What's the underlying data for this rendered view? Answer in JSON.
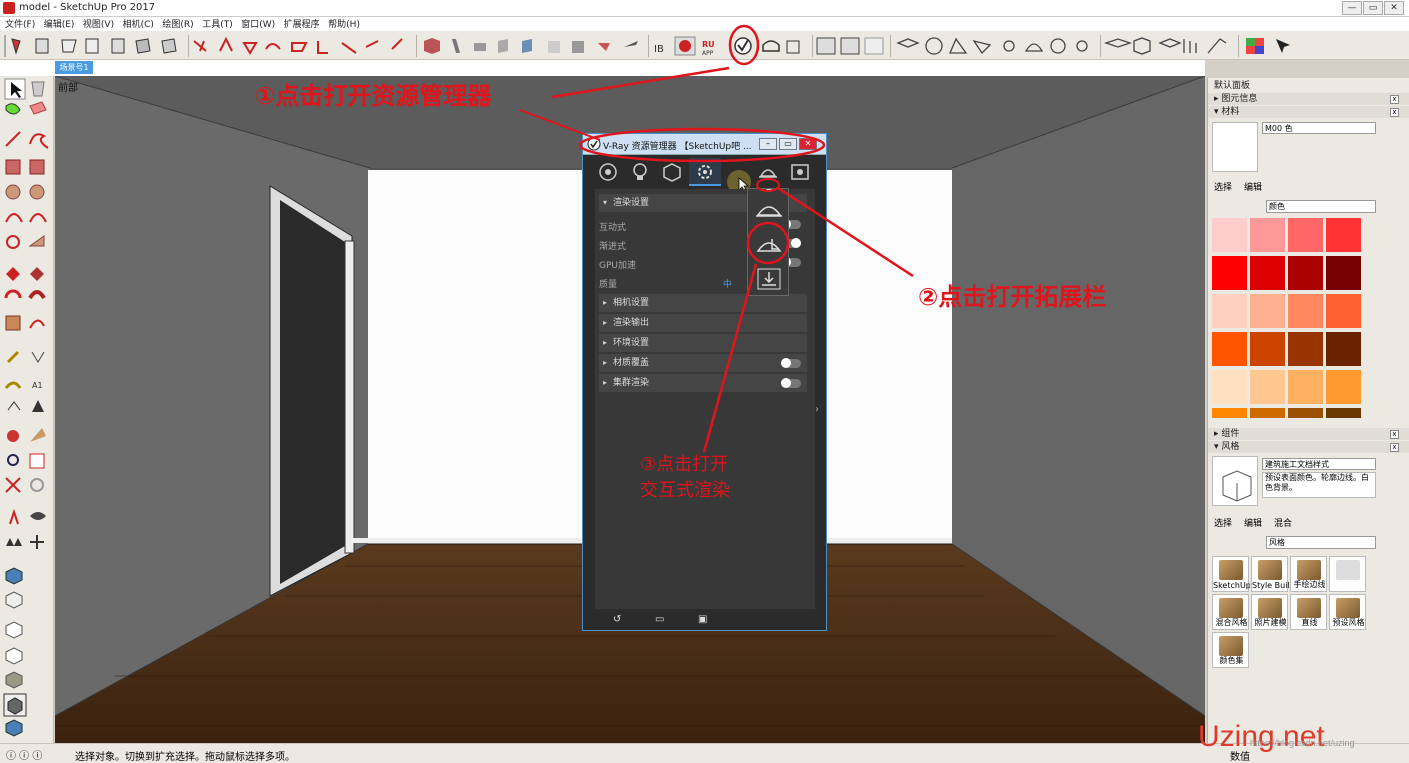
{
  "window": {
    "title": "model - SketchUp Pro 2017",
    "minimize": "—",
    "restore": "▭",
    "close": "✕"
  },
  "menu": [
    "文件(F)",
    "编辑(E)",
    "视图(V)",
    "相机(C)",
    "绘图(R)",
    "工具(T)",
    "窗口(W)",
    "扩展程序",
    "帮助(H)"
  ],
  "scene": {
    "tab_label": "场景号1",
    "view_label": "前部"
  },
  "vray": {
    "title": "V-Ray 资源管理器 【SketchUp吧 ...",
    "sections": {
      "render_settings": "渲染设置",
      "camera": "相机设置",
      "output": "渲染输出",
      "environment": "环境设置",
      "material_override": "材质覆盖",
      "swarm": "集群渲染"
    },
    "props": {
      "interactive": "互动式",
      "progressive": "渐进式",
      "gpu": "GPU加速",
      "quality": "质量",
      "quality_value": "中"
    },
    "toggles": {
      "interactive": false,
      "progressive": true,
      "gpu": false,
      "material_override": false,
      "swarm": false
    }
  },
  "annotations": {
    "step1": "①点击打开资源管理器",
    "step2": "②点击打开拓展栏",
    "step3_line1": "③点击打开",
    "step3_line2": "交互式渲染"
  },
  "tray": {
    "title": "默认面板",
    "entity_info": "图元信息",
    "materials": "材料",
    "material_name": "M00 色",
    "select_tab": "选择",
    "edit_tab": "编辑",
    "color_dropdown": "颜色",
    "components": "组件",
    "styles": "风格",
    "style_name": "建筑施工文档样式",
    "style_desc": "预设表面颜色。轮廓边线。白色背景。",
    "style_select_tab": "选择",
    "style_edit_tab": "编辑",
    "style_mix_tab": "混合",
    "style_dropdown": "风格",
    "style_items": [
      "SketchUp",
      "Style Buil",
      "手绘边线",
      "",
      "混合风格",
      "照片建模",
      "直线",
      "预设风格",
      "颜色集"
    ]
  },
  "swatch_colors": [
    "#ffcccc",
    "#ff9999",
    "#ff6666",
    "#ff3333",
    "#ff0000",
    "#dd0000",
    "#aa0000",
    "#770000",
    "#ffd0c0",
    "#ffb090",
    "#ff8860",
    "#ff6030",
    "#ff5500",
    "#cc4400",
    "#993300",
    "#6a2200",
    "#ffe0c0",
    "#ffc890",
    "#ffb060",
    "#ff9a30",
    "#ff8800",
    "#cc6a00",
    "#995000",
    "#6a3800"
  ],
  "status": {
    "message": "选择对象。切换到扩充选择。拖动鼠标选择多项。",
    "measurements": "数值"
  },
  "watermark": {
    "brand": "Uzing.net",
    "sub": "https://blog.csdn.net/uzing"
  }
}
